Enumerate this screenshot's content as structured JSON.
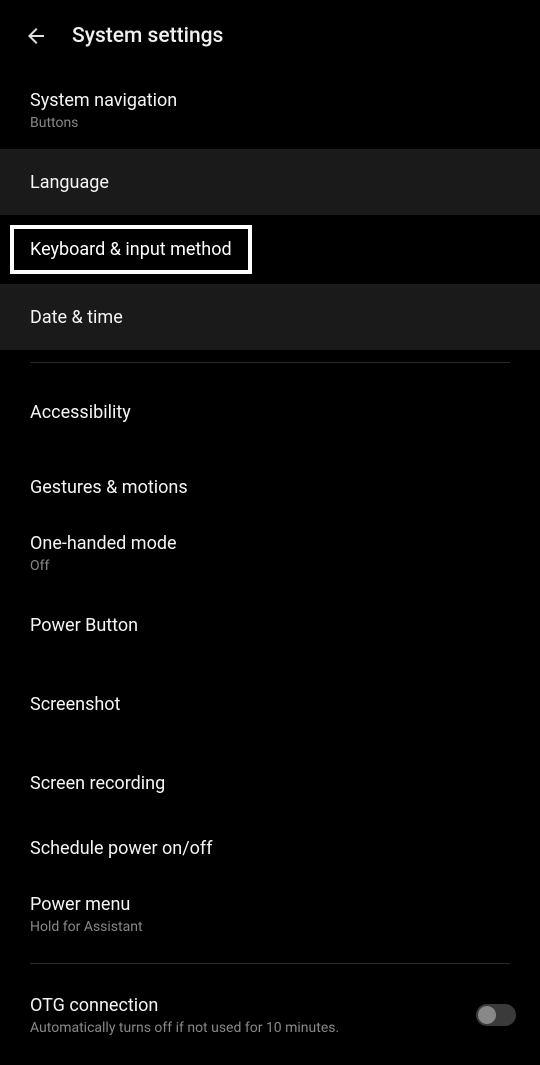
{
  "header": {
    "title": "System settings"
  },
  "items": {
    "system_navigation": {
      "title": "System navigation",
      "subtitle": "Buttons"
    },
    "language": {
      "title": "Language"
    },
    "keyboard_input": {
      "title": "Keyboard & input method"
    },
    "date_time": {
      "title": "Date & time"
    },
    "accessibility": {
      "title": "Accessibility"
    },
    "gestures_motions": {
      "title": "Gestures & motions"
    },
    "one_handed": {
      "title": "One-handed mode",
      "subtitle": "Off"
    },
    "power_button": {
      "title": "Power Button"
    },
    "screenshot": {
      "title": "Screenshot"
    },
    "screen_recording": {
      "title": "Screen recording"
    },
    "schedule_power": {
      "title": "Schedule power on/off"
    },
    "power_menu": {
      "title": "Power menu",
      "subtitle": "Hold for Assistant"
    },
    "otg": {
      "title": "OTG connection",
      "subtitle": "Automatically turns off if not used for 10 minutes."
    }
  }
}
